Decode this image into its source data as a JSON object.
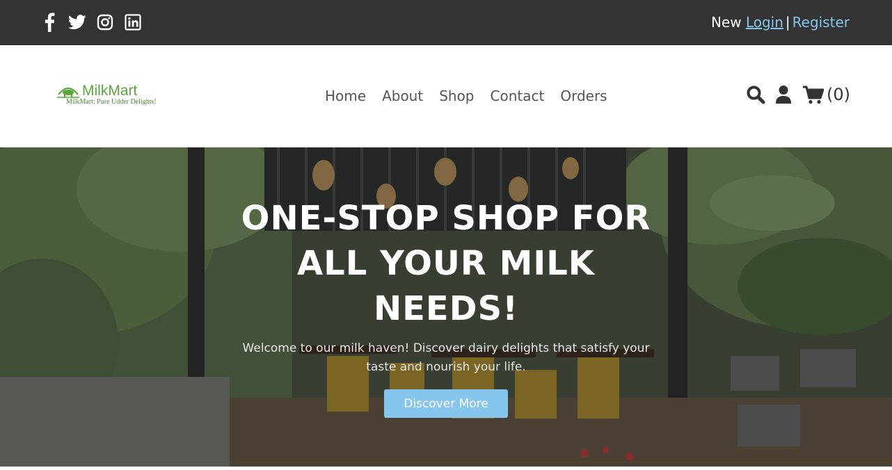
{
  "topbar": {
    "social": [
      {
        "icon": "facebook-icon"
      },
      {
        "icon": "twitter-icon"
      },
      {
        "icon": "instagram-icon"
      },
      {
        "icon": "linkedin-icon"
      }
    ],
    "auth": {
      "prefix": "New",
      "login_label": "Login",
      "separator": "|",
      "register_label": "Register"
    }
  },
  "header": {
    "logo": {
      "brand": "MilkMart",
      "tagline": "MilkMart: Pure Udder Delights!"
    },
    "nav": [
      "Home",
      "About",
      "Shop",
      "Contact",
      "Orders"
    ],
    "icons": [
      "search-icon",
      "user-icon",
      "cart-icon"
    ],
    "cart_count": "(0)"
  },
  "hero": {
    "title": "ONE-STOP SHOP FOR ALL YOUR MILK NEEDS!",
    "subtitle": "Welcome to our milk haven! Discover dairy delights that satisfy your taste and nourish your life.",
    "button_label": "Discover More"
  },
  "colors": {
    "topbar_bg": "#333333",
    "accent": "#86c6ec",
    "brand_green": "#5aa63c",
    "nav_text": "#555555"
  }
}
